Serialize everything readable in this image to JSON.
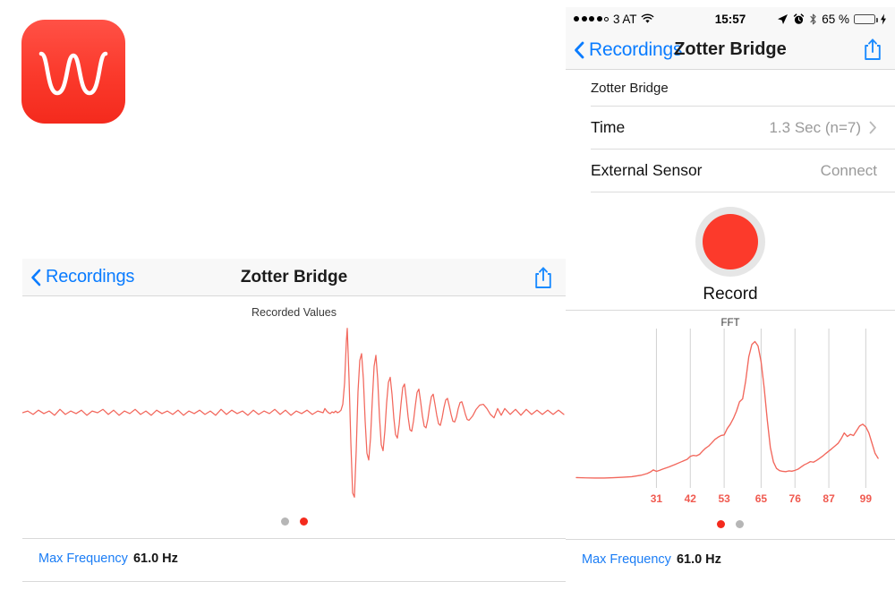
{
  "app": {
    "icon_name": "waveform-app-icon",
    "icon_color": "#fc3a2b"
  },
  "left_panel": {
    "navbar": {
      "back_label": "Recordings",
      "title": "Zotter Bridge",
      "share_icon": "share-icon"
    },
    "chart_title": "Recorded Values",
    "page_dots": [
      {
        "name": "page-dot-1",
        "active": false
      },
      {
        "name": "page-dot-2",
        "active": true
      }
    ],
    "footer": {
      "key": "Max Frequency",
      "value": "61.0 Hz"
    }
  },
  "right_panel": {
    "statusbar": {
      "signal_dots_filled": 4,
      "signal_dots_total": 5,
      "carrier": "3 AT",
      "wifi_icon": "wifi-icon",
      "time": "15:57",
      "location_icon": "location-arrow-icon",
      "alarm_icon": "alarm-clock-icon",
      "bluetooth_icon": "bluetooth-icon",
      "battery_percent": "65 %",
      "battery_level": 65,
      "battery_color": "#4cd964",
      "charging_icon": "lightning-bolt-icon"
    },
    "navbar": {
      "back_label": "Recordings",
      "title": "Zotter Bridge",
      "share_icon": "share-icon"
    },
    "rows": [
      {
        "label": "Zotter Bridge",
        "value": "",
        "chevron": false,
        "plain": true
      },
      {
        "label": "Time",
        "value": "1.3 Sec (n=7)",
        "chevron": true,
        "plain": false
      },
      {
        "label": "External Sensor",
        "value": "Connect",
        "chevron": false,
        "plain": false
      }
    ],
    "record": {
      "label": "Record",
      "button_name": "record-button",
      "color": "#fc3a2b"
    },
    "fft_title": "FFT",
    "page_dots": [
      {
        "name": "page-dot-1",
        "active": true
      },
      {
        "name": "page-dot-2",
        "active": false
      }
    ],
    "footer": {
      "key": "Max Frequency",
      "value": "61.0 Hz"
    }
  },
  "chart_data": [
    {
      "id": "recorded-values",
      "type": "line",
      "title": "Recorded Values",
      "xlabel": "",
      "ylabel": "",
      "grid": false,
      "legend": false,
      "line_color": "#f2675c",
      "description": "Damped oscillation impulse response: low-amplitude noise baseline, large positive spike, deep negative trough, then exponentially decaying ringing.",
      "xlim": [
        0,
        607
      ],
      "ylim": [
        -1.05,
        1.05
      ],
      "x": [
        0,
        6,
        12,
        18,
        24,
        30,
        36,
        42,
        48,
        54,
        60,
        66,
        72,
        78,
        84,
        90,
        96,
        102,
        108,
        114,
        120,
        126,
        132,
        138,
        144,
        150,
        156,
        162,
        168,
        174,
        180,
        186,
        192,
        198,
        204,
        210,
        216,
        222,
        228,
        234,
        240,
        246,
        252,
        258,
        264,
        270,
        276,
        282,
        288,
        294,
        300,
        306,
        312,
        318,
        324,
        330,
        336,
        338,
        340,
        342,
        344,
        346,
        348,
        350,
        352,
        354,
        356,
        358,
        360,
        362,
        363,
        365,
        367,
        369,
        371,
        373,
        375,
        377,
        379,
        381,
        383,
        385,
        387,
        389,
        391,
        393,
        395,
        397,
        399,
        401,
        403,
        405,
        407,
        409,
        411,
        413,
        415,
        417,
        419,
        421,
        423,
        425,
        427,
        429,
        431,
        433,
        435,
        437,
        439,
        441,
        443,
        445,
        447,
        449,
        451,
        453,
        455,
        457,
        459,
        461,
        463,
        465,
        467,
        469,
        471,
        473,
        475,
        477,
        479,
        481,
        483,
        485,
        487,
        489,
        491,
        493,
        495,
        497,
        499,
        503,
        507,
        511,
        515,
        519,
        523,
        527,
        531,
        535,
        539,
        545,
        551,
        557,
        563,
        569,
        575,
        581,
        587,
        593,
        599,
        605
      ],
      "y": [
        0.0,
        0.02,
        -0.02,
        0.03,
        -0.01,
        0.02,
        -0.03,
        0.04,
        -0.02,
        0.02,
        -0.01,
        0.03,
        -0.03,
        0.02,
        0.0,
        0.04,
        -0.02,
        0.03,
        -0.03,
        0.02,
        -0.01,
        0.04,
        -0.02,
        0.02,
        -0.03,
        0.03,
        -0.01,
        0.02,
        -0.02,
        0.03,
        -0.03,
        0.02,
        -0.01,
        0.03,
        -0.02,
        0.02,
        -0.03,
        0.04,
        -0.02,
        0.03,
        -0.01,
        0.02,
        -0.03,
        0.03,
        -0.02,
        0.02,
        -0.01,
        0.04,
        -0.02,
        0.03,
        -0.03,
        0.02,
        -0.01,
        0.03,
        -0.02,
        0.02,
        0.0,
        0.05,
        0.02,
        0.0,
        -0.01,
        0.01,
        0.0,
        0.02,
        0.0,
        0.01,
        0.03,
        0.1,
        0.35,
        0.85,
        1.0,
        0.4,
        -0.35,
        -0.95,
        -1.0,
        -0.45,
        0.25,
        0.62,
        0.7,
        0.4,
        -0.1,
        -0.48,
        -0.56,
        -0.3,
        0.15,
        0.55,
        0.68,
        0.4,
        -0.05,
        -0.38,
        -0.45,
        -0.22,
        0.12,
        0.36,
        0.42,
        0.22,
        -0.06,
        -0.26,
        -0.3,
        -0.14,
        0.1,
        0.3,
        0.34,
        0.16,
        -0.05,
        -0.2,
        -0.22,
        -0.1,
        0.08,
        0.24,
        0.28,
        0.13,
        -0.04,
        -0.16,
        -0.18,
        -0.08,
        0.07,
        0.19,
        0.22,
        0.1,
        -0.03,
        -0.13,
        -0.15,
        -0.06,
        0.06,
        0.15,
        0.17,
        0.08,
        -0.02,
        -0.1,
        -0.11,
        -0.05,
        0.05,
        0.12,
        0.13,
        0.06,
        -0.02,
        -0.08,
        -0.09,
        -0.04,
        0.04,
        0.09,
        0.1,
        0.05,
        -0.02,
        -0.06,
        0.05,
        -0.03,
        0.05,
        -0.02,
        0.04,
        -0.03,
        0.04,
        -0.02,
        0.03,
        -0.02,
        0.03,
        -0.02,
        0.03,
        -0.02,
        0.02,
        -0.02,
        0.02,
        -0.01,
        0.02,
        -0.01
      ]
    },
    {
      "id": "fft",
      "type": "line",
      "title": "FFT",
      "xlabel": "",
      "ylabel": "",
      "grid": true,
      "grid_axis": "x",
      "legend": false,
      "line_color": "#f2675c",
      "description": "Frequency spectrum with a dominant sharp peak at 61 Hz and a secondary broad rise toward 95-99 Hz.",
      "xticks": [
        31,
        42,
        53,
        65,
        76,
        87,
        99
      ],
      "xlim": [
        5,
        105
      ],
      "ylim": [
        0,
        1.0
      ],
      "peak_frequency": 61.0,
      "x": [
        5,
        8,
        11,
        14,
        17,
        20,
        23,
        26,
        28,
        29,
        30,
        31,
        32,
        33,
        35,
        37,
        39,
        41,
        42,
        43,
        44,
        45,
        46,
        47,
        48,
        49,
        50,
        51,
        52,
        53,
        54,
        55,
        56,
        57,
        58,
        59,
        60,
        61,
        62,
        63,
        64,
        65,
        66,
        67,
        68,
        69,
        70,
        71,
        72,
        73,
        74,
        75,
        76,
        77,
        78,
        79,
        80,
        81,
        82,
        83,
        84,
        85,
        86,
        87,
        88,
        89,
        90,
        91,
        92,
        93,
        94,
        95,
        96,
        97,
        98,
        99,
        100,
        101,
        102,
        103
      ],
      "y": [
        0.022,
        0.02,
        0.019,
        0.019,
        0.021,
        0.024,
        0.028,
        0.038,
        0.05,
        0.06,
        0.075,
        0.065,
        0.072,
        0.08,
        0.095,
        0.112,
        0.13,
        0.148,
        0.168,
        0.175,
        0.172,
        0.182,
        0.205,
        0.225,
        0.24,
        0.262,
        0.285,
        0.3,
        0.312,
        0.316,
        0.36,
        0.39,
        0.43,
        0.48,
        0.545,
        0.565,
        0.69,
        0.855,
        0.94,
        0.96,
        0.93,
        0.82,
        0.64,
        0.42,
        0.23,
        0.13,
        0.085,
        0.07,
        0.065,
        0.063,
        0.068,
        0.066,
        0.072,
        0.08,
        0.095,
        0.11,
        0.12,
        0.132,
        0.128,
        0.14,
        0.155,
        0.17,
        0.188,
        0.205,
        0.222,
        0.24,
        0.258,
        0.29,
        0.33,
        0.305,
        0.32,
        0.312,
        0.345,
        0.378,
        0.39,
        0.372,
        0.33,
        0.26,
        0.19,
        0.155
      ]
    }
  ]
}
